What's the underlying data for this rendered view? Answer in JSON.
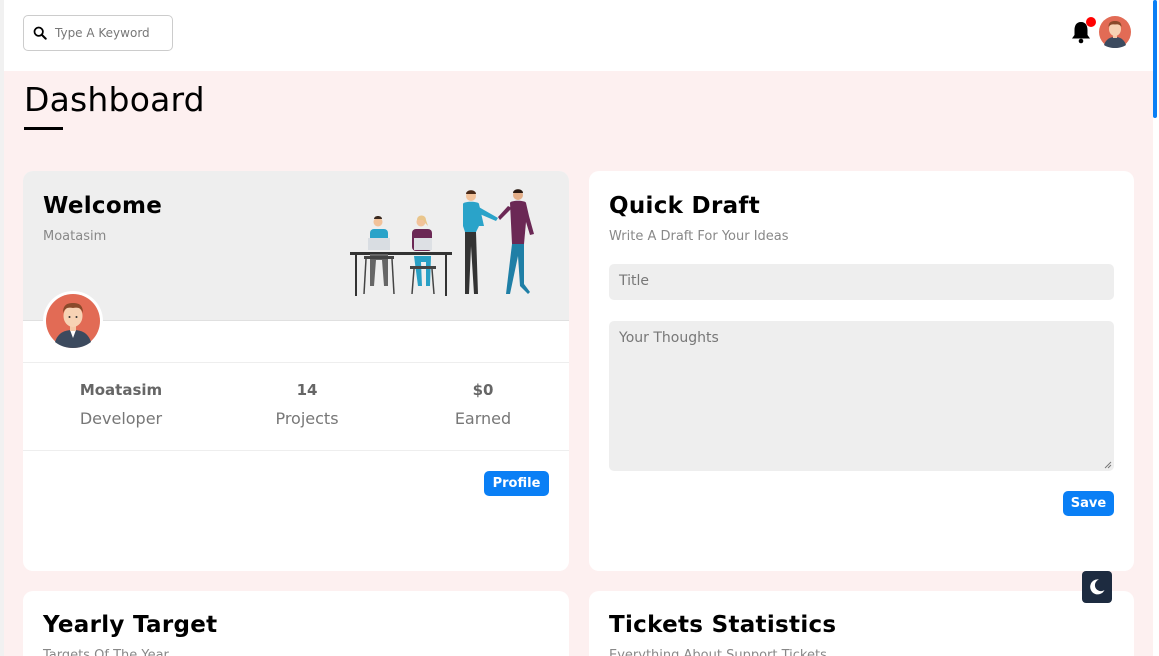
{
  "search": {
    "placeholder": "Type A Keyword",
    "icon": "search-icon"
  },
  "header": {
    "notification_icon": "bell-icon",
    "avatar": "avatar"
  },
  "page": {
    "title": "Dashboard"
  },
  "welcome": {
    "title": "Welcome",
    "subtitle": "Moatasim",
    "stats": [
      {
        "value": "Moatasim",
        "label": "Developer"
      },
      {
        "value": "14",
        "label": "Projects"
      },
      {
        "value": "$0",
        "label": "Earned"
      }
    ],
    "profile_button": "Profile"
  },
  "draft": {
    "title": "Quick Draft",
    "subtitle": "Write A Draft For Your Ideas",
    "title_placeholder": "Title",
    "thoughts_placeholder": "Your Thoughts",
    "save_button": "Save"
  },
  "target": {
    "title": "Yearly Target",
    "subtitle": "Targets Of The Year"
  },
  "tickets": {
    "title": "Tickets Statistics",
    "subtitle": "Everything About Support Tickets"
  },
  "theme_toggle": {
    "icon": "moon-icon"
  },
  "colors": {
    "accent": "#0a7ff5",
    "page_bg": "#fdf0f0",
    "notification": "#ff0000",
    "dark_button": "#1d2b40"
  }
}
